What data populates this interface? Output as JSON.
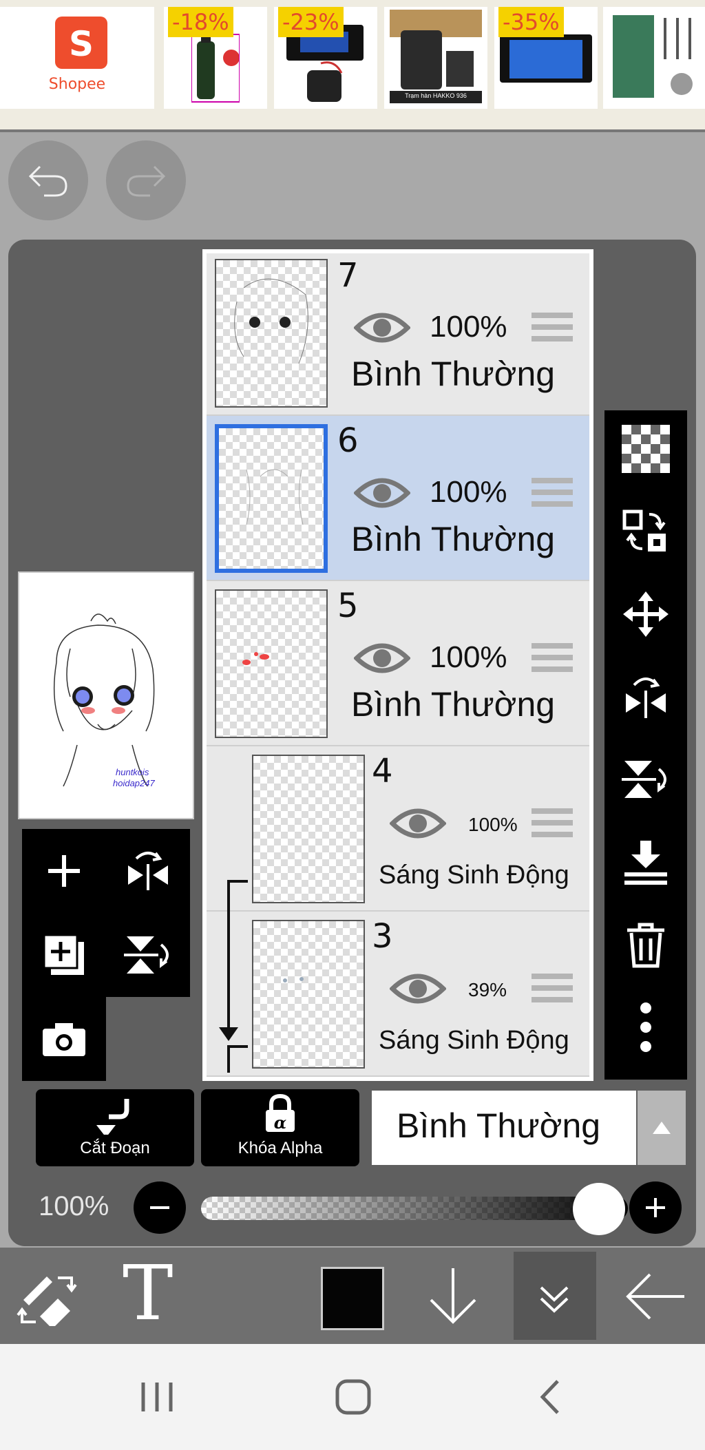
{
  "ad": {
    "brand": "Shopee",
    "menu_icon": "hamburger-icon",
    "discounts": [
      "-18%",
      "-23%",
      "",
      "-35%",
      ""
    ],
    "product_caption": "Trạm hàn HAKKO 936"
  },
  "top_controls": {
    "undo_icon": "undo-icon",
    "redo_icon": "redo-icon"
  },
  "preview": {
    "watermark_line1": "huntkois",
    "watermark_line2": "hoidap247"
  },
  "layers": [
    {
      "number": "7",
      "opacity": "100%",
      "blend": "Bình Thường",
      "selected": false,
      "clipped": false
    },
    {
      "number": "6",
      "opacity": "100%",
      "blend": "Bình Thường",
      "selected": true,
      "clipped": false
    },
    {
      "number": "5",
      "opacity": "100%",
      "blend": "Bình Thường",
      "selected": false,
      "clipped": false
    },
    {
      "number": "4",
      "opacity": "100%",
      "blend": "Sáng Sinh Động",
      "selected": false,
      "clipped": true
    },
    {
      "number": "3",
      "opacity": "39%",
      "blend": "Sáng Sinh Động",
      "selected": false,
      "clipped": true
    }
  ],
  "sidebar_tools": [
    "transparent-icon",
    "swap-layer-icon",
    "move-icon",
    "flip-horizontal-icon",
    "flip-vertical-icon",
    "merge-down-icon",
    "trash-icon",
    "more-vertical-icon"
  ],
  "layer_tools": [
    "add-layer-icon",
    "flip-icon",
    "duplicate-layer-icon",
    "rotate-icon",
    "camera-icon"
  ],
  "clip_button": {
    "label": "Cắt Đoạn"
  },
  "alpha_lock_button": {
    "label": "Khóa Alpha",
    "glyph": "α"
  },
  "blend_mode": {
    "value": "Bình Thường"
  },
  "opacity": {
    "label": "100%",
    "value": 1.0
  },
  "bottom_toolbar": {
    "text_tool_label": "T",
    "color_hex": "#050505",
    "icons": [
      "swap-tool-icon",
      "text-icon",
      "color-swatch",
      "arrow-down-icon",
      "double-chevron-down-icon",
      "arrow-left-icon"
    ]
  },
  "system_nav": [
    "recents-icon",
    "home-icon",
    "back-icon"
  ]
}
